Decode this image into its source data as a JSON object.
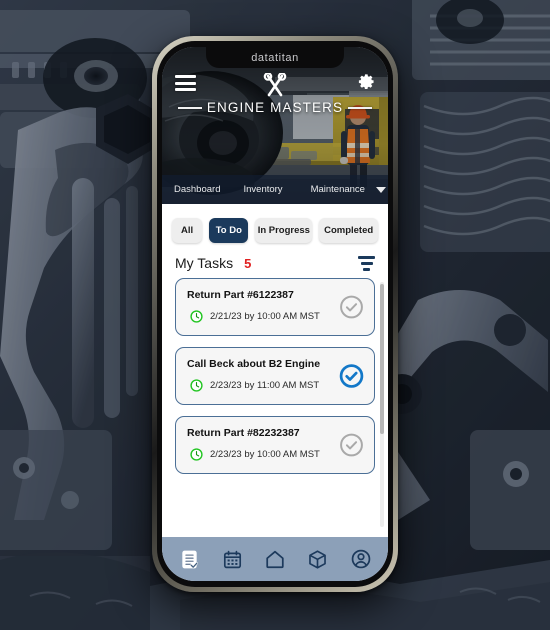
{
  "device": {
    "notch_brand": "datatitan"
  },
  "hero": {
    "menu_icon": "hamburger-menu-icon",
    "settings_icon": "gear-icon",
    "logo_tools_icon": "crossed-wrenches-icon",
    "logo_text": "ENGINE MASTERS"
  },
  "section_nav": {
    "items": [
      {
        "label": "Dashboard"
      },
      {
        "label": "Inventory"
      },
      {
        "label": "Maintenance"
      }
    ],
    "caret_icon": "chevron-down-icon"
  },
  "chips": [
    {
      "label": "All",
      "active": false
    },
    {
      "label": "To Do",
      "active": true
    },
    {
      "label": "In Progress",
      "active": false
    },
    {
      "label": "Completed",
      "active": false
    }
  ],
  "tasks_section": {
    "title": "My Tasks",
    "count": "5",
    "filter_icon": "filter-funnel-icon"
  },
  "tasks": [
    {
      "title": "Return Part #6122387",
      "clock_icon": "clock-icon",
      "date": "2/21/23 by 10:00 AM MST",
      "check_icon": "check-circle-icon",
      "checked": false
    },
    {
      "title": "Call Beck about B2 Engine",
      "clock_icon": "clock-icon",
      "date": "2/23/23 by 11:00 AM MST",
      "check_icon": "check-circle-icon",
      "checked": true
    },
    {
      "title": "Return Part #82232387",
      "clock_icon": "clock-icon",
      "date": "2/23/23 by 10:00 AM MST",
      "check_icon": "check-circle-icon",
      "checked": false
    }
  ],
  "bottom_nav": [
    {
      "icon": "checklist-document-icon",
      "active": true
    },
    {
      "icon": "calendar-icon",
      "active": false
    },
    {
      "icon": "home-icon",
      "active": false
    },
    {
      "icon": "package-box-icon",
      "active": false
    },
    {
      "icon": "account-profile-icon",
      "active": false
    }
  ],
  "colors": {
    "accent_navy": "#1b3a5c",
    "count_red": "#e02020",
    "check_blue": "#1378c8",
    "clock_green": "#22c522",
    "bottom_nav": "#8ca0b8",
    "card_border": "#4b6f96"
  }
}
